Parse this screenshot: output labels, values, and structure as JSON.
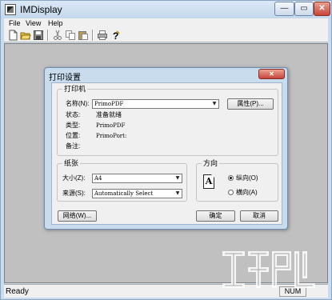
{
  "window": {
    "title": "IMDisplay",
    "controls": {
      "minimize": "—",
      "maximize": "▭",
      "close": "✕"
    }
  },
  "menubar": {
    "items": [
      "File",
      "View",
      "Help"
    ]
  },
  "toolbar": {
    "buttons": [
      "new-icon",
      "open-icon",
      "save-icon",
      "cut-icon",
      "copy-icon",
      "paste-icon",
      "print-icon",
      "help-icon"
    ]
  },
  "status": {
    "text": "Ready",
    "num": "NUM"
  },
  "dialog": {
    "title": "打印设置",
    "close_label": "✕",
    "printer_group": {
      "title": "打印机",
      "name_label": "名称(N):",
      "name_value": "PrimoPDF",
      "properties_button": "属性(P)...",
      "status_label": "状态:",
      "status_value": "准备就绪",
      "type_label": "类型:",
      "type_value": "PrimoPDF",
      "where_label": "位置:",
      "where_value": "PrimoPort:",
      "comment_label": "备注:",
      "comment_value": ""
    },
    "paper_group": {
      "title": "纸张",
      "size_label": "大小(Z):",
      "size_value": "A4",
      "source_label": "来源(S):",
      "source_value": "Automatically Select"
    },
    "orientation_group": {
      "title": "方向",
      "preview_letter": "A",
      "portrait_label": "纵向(O)",
      "landscape_label": "横向(A)",
      "selected": "portrait"
    },
    "network_button": "网络(W)...",
    "ok_button": "确定",
    "cancel_button": "取消"
  },
  "watermark": {
    "logo": "download-site-watermark"
  },
  "colors": {
    "frame": "#c8dcee",
    "client": "#c0c0c0",
    "face": "#f0f0f0",
    "close": "#c8453a"
  }
}
